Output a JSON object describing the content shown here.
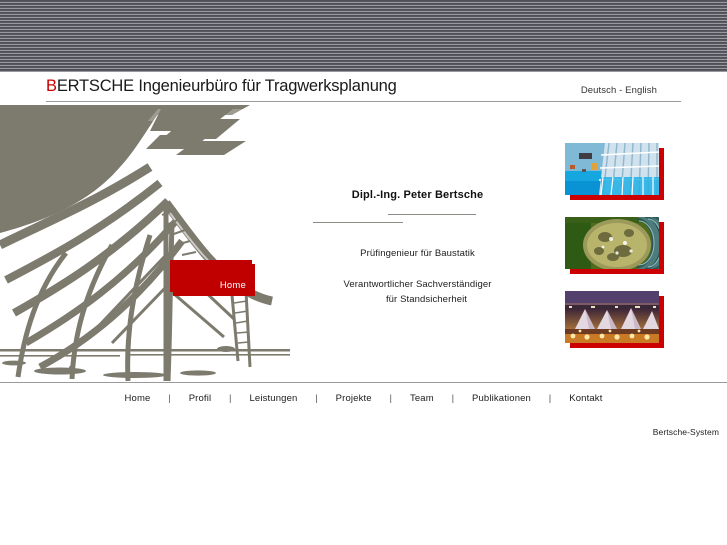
{
  "header": {
    "title_initial": "B",
    "title_rest": "ERTSCHE Ingenieurbüro für Tragwerksplanung",
    "title_full": "BERTSCHE Ingenieurbüro für Tragwerksplanung",
    "language_links": "Deutsch - English",
    "language": {
      "german": "Deutsch",
      "separator": "-",
      "english": "English"
    },
    "accent_color": "#cc0000",
    "stripe_dark": "#53535b",
    "stripe_light": "#a3a3a9"
  },
  "hero": {
    "home_button_label": "Home",
    "home_button_color": "#c00000",
    "artwork_name": "steel-roof-structure-photo",
    "artwork_color": "#7d7a6e"
  },
  "center": {
    "owner_name": "Dipl.-Ing. Peter Bertsche",
    "role_primary": "Prüfingenieur für Baustatik",
    "role_secondary_line1": "Verantwortlicher Sachverständiger",
    "role_secondary_line2": "für Standsicherheit"
  },
  "thumbnails": [
    {
      "id": "thumb-pool-glass-roof",
      "alt": "Schwimmbad mit Glasdachkonstruktion",
      "shadow_color": "#cc0000"
    },
    {
      "id": "thumb-dome-structure",
      "alt": "Kuppelkonstruktion im Grünen",
      "shadow_color": "#cc0000"
    },
    {
      "id": "thumb-tent-roof-night",
      "alt": "Zeltdachkonstruktion bei Nacht",
      "shadow_color": "#cc0000"
    }
  ],
  "nav": {
    "separator": "|",
    "items": [
      {
        "label": "Home"
      },
      {
        "label": "Profil"
      },
      {
        "label": "Leistungen"
      },
      {
        "label": "Projekte"
      },
      {
        "label": "Team"
      },
      {
        "label": "Publikationen"
      },
      {
        "label": "Kontakt"
      }
    ]
  },
  "footer": {
    "note": "Bertsche-System"
  }
}
